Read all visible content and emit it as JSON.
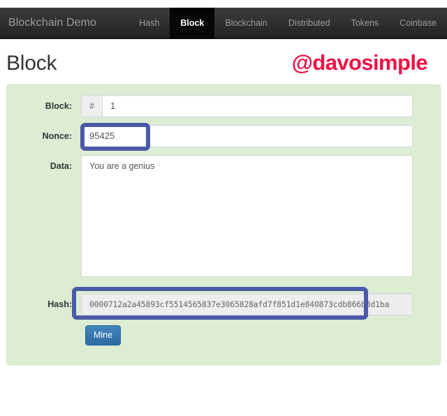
{
  "navbar": {
    "brand": "Blockchain Demo",
    "links": [
      {
        "label": "Hash",
        "active": false
      },
      {
        "label": "Block",
        "active": true
      },
      {
        "label": "Blockchain",
        "active": false
      },
      {
        "label": "Distributed",
        "active": false
      },
      {
        "label": "Tokens",
        "active": false
      },
      {
        "label": "Coinbase",
        "active": false
      }
    ]
  },
  "page": {
    "title": "Block",
    "watermark": "@davosimple"
  },
  "form": {
    "block": {
      "label": "Block:",
      "addon": "#",
      "value": "1"
    },
    "nonce": {
      "label": "Nonce:",
      "value": "95425"
    },
    "data": {
      "label": "Data:",
      "value": "You are a genius"
    },
    "hash": {
      "label": "Hash:",
      "value": "0000712a2a45893cf5514565837e3065828afd7f851d1e840873cdb866b8d1ba"
    },
    "mine_button": "Mine"
  },
  "colors": {
    "panel_green": "#dcedd4",
    "highlight_blue": "#4a5aa8",
    "watermark_red": "#ee1144",
    "navbar_dark": "#222222",
    "button_blue": "#2d6ca2"
  }
}
